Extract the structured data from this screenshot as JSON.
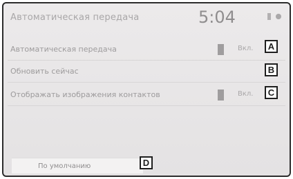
{
  "header": {
    "title": "Автоматическая передача",
    "clock": "5:04",
    "signal_icon": "signal-icon",
    "settings_icon": "gear-icon"
  },
  "rows": [
    {
      "label": "Автоматическая передача",
      "toggle_text": "Вкл.",
      "callout": "A"
    },
    {
      "label": "Обновить сейчас",
      "callout": "B"
    },
    {
      "label": "Отображать изображения контактов",
      "toggle_text": "Вкл.",
      "callout": "C"
    }
  ],
  "footer": {
    "default_button": "По умолчанию",
    "callout": "D"
  }
}
